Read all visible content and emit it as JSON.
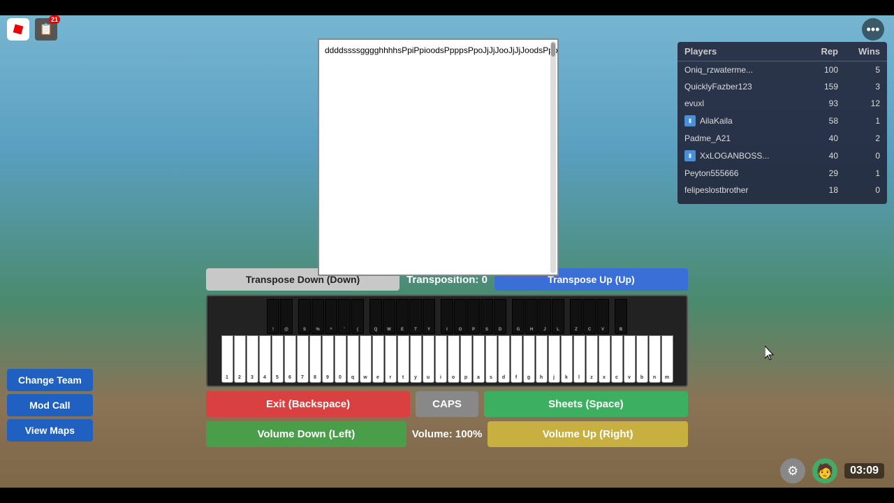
{
  "topBar": {
    "notificationCount": "21"
  },
  "sheet": {
    "content": "ddddssssgggghhhhsPpiPpioodsPpppsPpoJjJjJooJjJjJoodsPpppsPpoJjJjJooJjJjJo"
  },
  "transpose": {
    "downLabel": "Transpose Down (Down)",
    "upLabel": "Transpose Up (Up)",
    "transpositionLabel": "Transposition: 0"
  },
  "volume": {
    "downLabel": "Volume Down (Left)",
    "upLabel": "Volume Up (Right)",
    "volumeLabel": "Volume: 100%"
  },
  "controls": {
    "exitLabel": "Exit (Backspace)",
    "capsLabel": "CAPS",
    "sheetsLabel": "Sheets (Space)"
  },
  "leaderboard": {
    "headers": [
      "Players",
      "Rep",
      "Wins"
    ],
    "rows": [
      {
        "name": "Oniq_rzwaterme...",
        "rep": "100",
        "wins": "5",
        "hasIcon": false
      },
      {
        "name": "QuicklyFazber123",
        "rep": "159",
        "wins": "3",
        "hasIcon": false
      },
      {
        "name": "evuxl",
        "rep": "93",
        "wins": "12",
        "hasIcon": false
      },
      {
        "name": "AilaKaila",
        "rep": "58",
        "wins": "1",
        "hasIcon": true
      },
      {
        "name": "Padme_A21",
        "rep": "40",
        "wins": "2",
        "hasIcon": false
      },
      {
        "name": "XxLOGANBOSS...",
        "rep": "40",
        "wins": "0",
        "hasIcon": true
      },
      {
        "name": "Peyton555666",
        "rep": "29",
        "wins": "1",
        "hasIcon": false
      },
      {
        "name": "felipeslostbrother",
        "rep": "18",
        "wins": "0",
        "hasIcon": false
      }
    ]
  },
  "sideButtons": [
    {
      "label": "Change Team",
      "key": "change-team"
    },
    {
      "label": "Mod Call",
      "key": "mod-call"
    },
    {
      "label": "View Maps",
      "key": "view-maps"
    }
  ],
  "timer": {
    "display": "03:09"
  },
  "pianoKeys": {
    "topRow": [
      "!",
      "@",
      "S",
      "%",
      "^",
      "'",
      "(",
      "Q",
      "W",
      "E",
      "T",
      "Y",
      "I",
      "O",
      "P",
      "S",
      "D",
      "G",
      "H",
      "J",
      "L",
      "Z",
      "C",
      "V",
      "B"
    ],
    "bottomRow": [
      "1",
      "2",
      "3",
      "4",
      "5",
      "6",
      "7",
      "8",
      "9",
      "0",
      "q",
      "w",
      "e",
      "r",
      "t",
      "y",
      "u",
      "i",
      "o",
      "p",
      "a",
      "s",
      "d",
      "f",
      "g",
      "h",
      "j",
      "k",
      "l",
      "z",
      "x",
      "c",
      "v",
      "b",
      "n",
      "m"
    ]
  }
}
